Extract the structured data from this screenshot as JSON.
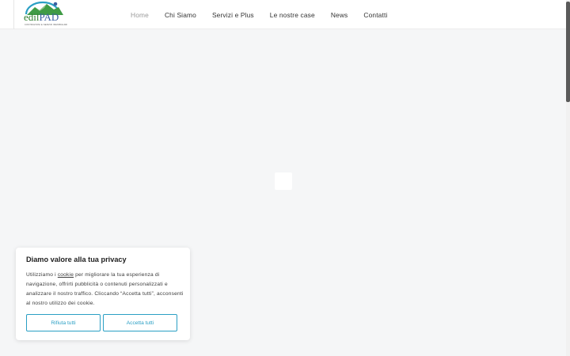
{
  "header": {
    "logo": {
      "name_part1": "edil",
      "name_part2": "PAD",
      "tagline": "COSTRUZIONI E SERVIZI IMMOBILIARI"
    },
    "nav": [
      {
        "label": "Home",
        "active": true
      },
      {
        "label": "Chi Siamo",
        "active": false
      },
      {
        "label": "Servizi e Plus",
        "active": false
      },
      {
        "label": "Le nostre case",
        "active": false
      },
      {
        "label": "News",
        "active": false
      },
      {
        "label": "Contatti",
        "active": false
      }
    ]
  },
  "cookie_banner": {
    "title": "Diamo valore alla tua privacy",
    "text_before_link": "Utilizziamo i ",
    "link_text": "cookie",
    "text_after_link": " per migliorare la tua esperienza di navigazione, offrirti pubblicità o contenuti personalizzati e analizzare il nostro traffico. Cliccando “Accetta tutti”, acconsenti al nostro utilizzo dei cookie.",
    "reject_label": "Rifiuta tutti",
    "accept_label": "Accetta tutti"
  },
  "colors": {
    "accent": "#2a9fc4",
    "page_background": "#f5f6f7",
    "nav_active": "#9a9a9a",
    "logo_green": "#2e7d2e",
    "logo_blue": "#3a5fa0"
  }
}
